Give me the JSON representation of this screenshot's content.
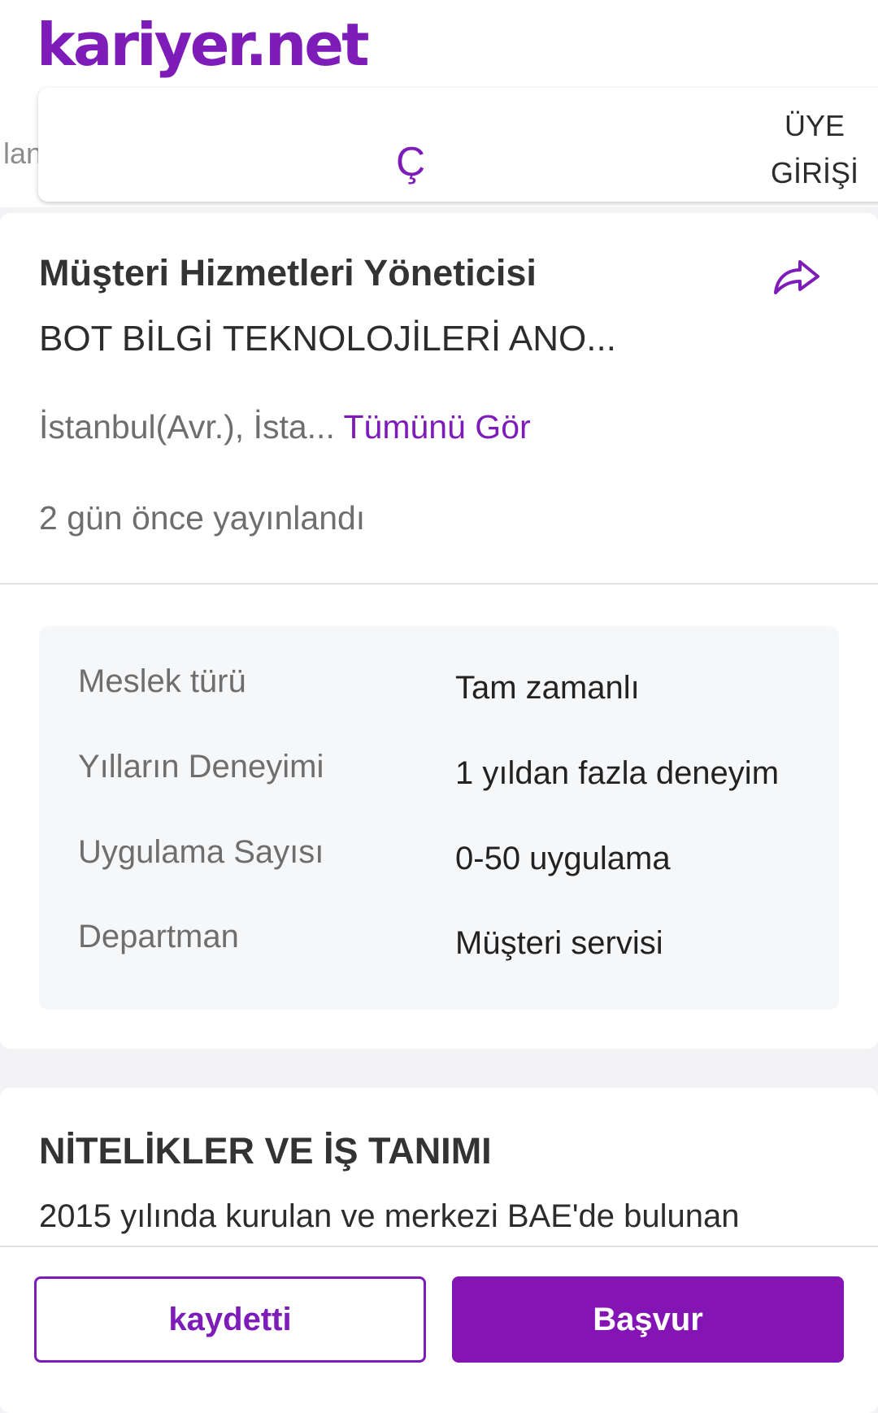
{
  "header": {
    "logo": "kariyer.net",
    "menu_peek": "lan",
    "nav_mid": "Ç",
    "login_line1": "ÜYE",
    "login_line2": "GİRİŞİ"
  },
  "job": {
    "title": "Müşteri Hizmetleri Yöneticisi",
    "company": "BOT BİLGİ TEKNOLOJİLERİ ANO...",
    "location": "İstanbul(Avr.), İsta...",
    "see_all": "Tümünü Gör",
    "posted": "2 gün önce yayınlandı",
    "share_icon": "share-icon"
  },
  "details": [
    {
      "label": "Meslek türü",
      "value": "Tam zamanlı"
    },
    {
      "label": "Yılların Deneyimi",
      "value": "1 yıldan fazla deneyim"
    },
    {
      "label": "Uygulama Sayısı",
      "value": "0-50 uygulama"
    },
    {
      "label": "Departman",
      "value": "Müşteri servisi"
    }
  ],
  "description": {
    "title": "NİTELİKLER VE İŞ TANIMI",
    "text": "2015 yılında kurulan ve merkezi BAE'de bulunan"
  },
  "actions": {
    "save_label": "kaydetti",
    "apply_label": "Başvur"
  },
  "colors": {
    "brand": "#7d1cb8",
    "apply_button": "#8415b4"
  }
}
